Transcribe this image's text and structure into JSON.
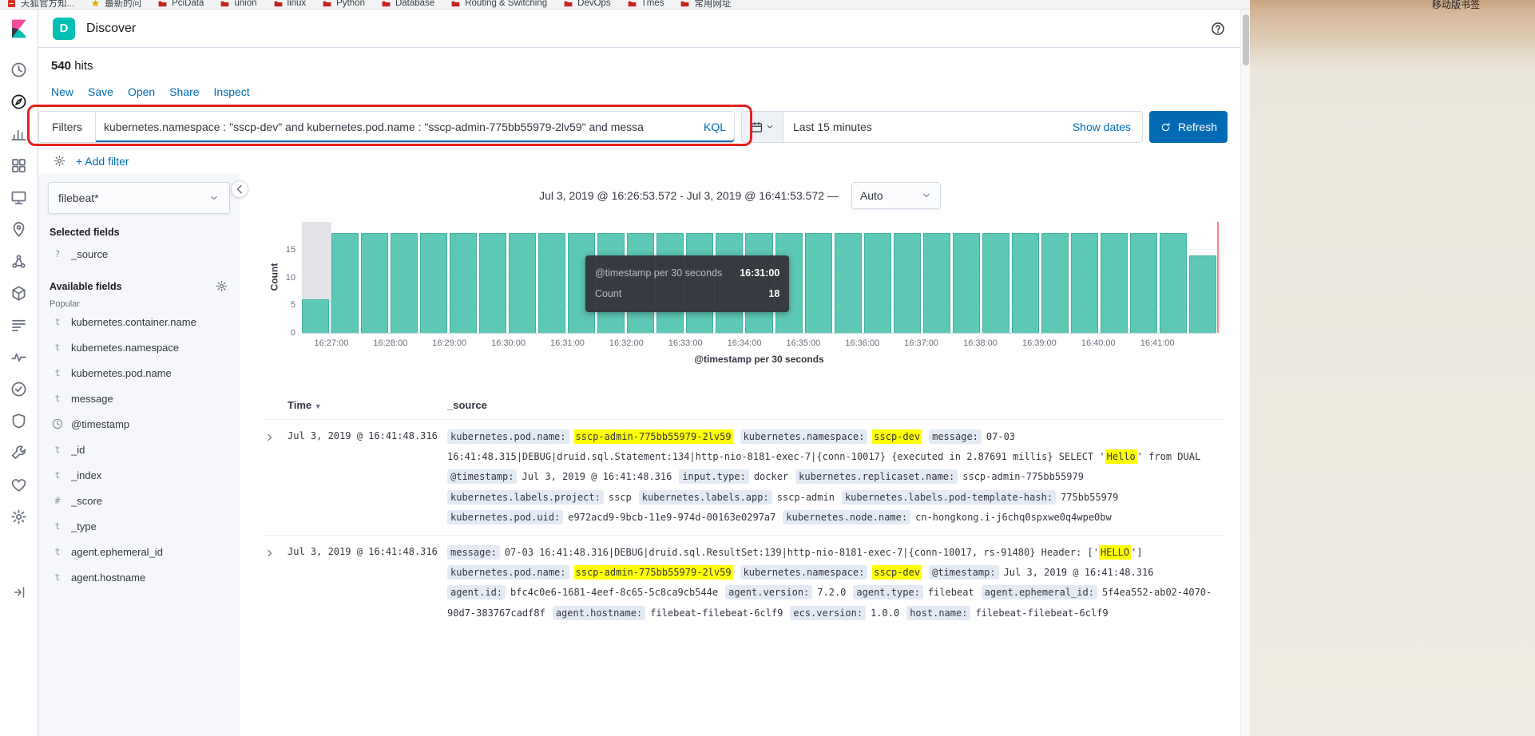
{
  "colors": {
    "accent": "#006bb4",
    "space_badge": "#00bfb3",
    "bar_fill": "#5dc8b6",
    "highlight": "#ffff00",
    "annotation": "#e0231e"
  },
  "browser": {
    "bookmarks": [
      {
        "label": "天狐官方知...",
        "icon": "site"
      },
      {
        "label": "最新的问",
        "icon": "star"
      },
      {
        "label": "PciData",
        "icon": "folder"
      },
      {
        "label": "union",
        "icon": "folder"
      },
      {
        "label": "linux",
        "icon": "folder"
      },
      {
        "label": "Python",
        "icon": "folder"
      },
      {
        "label": "Database",
        "icon": "folder"
      },
      {
        "label": "Routing & Switching",
        "icon": "folder"
      },
      {
        "label": "DevOps",
        "icon": "folder"
      },
      {
        "label": "Tmes",
        "icon": "folder"
      },
      {
        "label": "常用网址",
        "icon": "folder"
      }
    ],
    "right_text": "移动版书签"
  },
  "app_header": {
    "space_initial": "D",
    "title": "Discover"
  },
  "hits": {
    "count": "540",
    "label": "hits"
  },
  "menu": {
    "items": [
      "New",
      "Save",
      "Open",
      "Share",
      "Inspect"
    ]
  },
  "query_bar": {
    "filters_label": "Filters",
    "query": "kubernetes.namespace : \"sscp-dev\" and kubernetes.pod.name : \"sscp-admin-775bb55979-2lv59\"   and messa",
    "language": "KQL",
    "time_range": "Last 15 minutes",
    "show_dates_label": "Show dates",
    "refresh_label": "Refresh"
  },
  "filter_bar": {
    "add_filter_label": "+ Add filter"
  },
  "nav": {
    "items": [
      {
        "name": "recently-viewed",
        "icon": "clock"
      },
      {
        "name": "discover",
        "icon": "compass",
        "active": true
      },
      {
        "name": "visualize",
        "icon": "visualize"
      },
      {
        "name": "dashboard",
        "icon": "dashboard"
      },
      {
        "name": "canvas",
        "icon": "canvas"
      },
      {
        "name": "maps",
        "icon": "maps"
      },
      {
        "name": "machine-learning",
        "icon": "ml"
      },
      {
        "name": "infrastructure",
        "icon": "infrastructure"
      },
      {
        "name": "logs",
        "icon": "logs"
      },
      {
        "name": "apm",
        "icon": "apm"
      },
      {
        "name": "uptime",
        "icon": "uptime"
      },
      {
        "name": "siem",
        "icon": "siem"
      },
      {
        "name": "dev-tools",
        "icon": "wrench"
      },
      {
        "name": "stack-monitoring",
        "icon": "heart"
      },
      {
        "name": "management",
        "icon": "gear"
      }
    ]
  },
  "fields_panel": {
    "index_pattern": "filebeat*",
    "selected_title": "Selected fields",
    "selected": [
      {
        "type": "?",
        "name": "_source"
      }
    ],
    "available_title": "Available fields",
    "popular_title": "Popular",
    "popular": [
      {
        "type": "t",
        "name": "kubernetes.container.name"
      },
      {
        "type": "t",
        "name": "kubernetes.namespace"
      },
      {
        "type": "t",
        "name": "kubernetes.pod.name"
      },
      {
        "type": "t",
        "name": "message"
      }
    ],
    "available": [
      {
        "type": "clock",
        "name": "@timestamp"
      },
      {
        "type": "t",
        "name": "_id"
      },
      {
        "type": "t",
        "name": "_index"
      },
      {
        "type": "#",
        "name": "_score"
      },
      {
        "type": "t",
        "name": "_type"
      },
      {
        "type": "t",
        "name": "agent.ephemeral_id"
      },
      {
        "type": "t",
        "name": "agent.hostname"
      }
    ]
  },
  "chart": {
    "time_range_title": "Jul 3, 2019 @ 16:26:53.572 - Jul 3, 2019 @ 16:41:53.572 —",
    "interval_label": "Auto",
    "tooltip": {
      "series_label": "@timestamp per 30 seconds",
      "bucket": "16:31:00",
      "count_label": "Count",
      "count_value": "18"
    }
  },
  "chart_data": {
    "type": "bar",
    "title": "",
    "xlabel": "@timestamp per 30 seconds",
    "ylabel": "Count",
    "ylim": [
      0,
      20
    ],
    "yticks": [
      0,
      5,
      10,
      15
    ],
    "bucket_interval": "30 seconds",
    "time_range": [
      "16:26:53.572",
      "16:41:53.572"
    ],
    "x_tick_labels": [
      "16:27:00",
      "16:28:00",
      "16:29:00",
      "16:30:00",
      "16:31:00",
      "16:32:00",
      "16:33:00",
      "16:34:00",
      "16:35:00",
      "16:36:00",
      "16:37:00",
      "16:38:00",
      "16:39:00",
      "16:40:00",
      "16:41:00"
    ],
    "values": [
      6,
      18,
      18,
      18,
      18,
      18,
      18,
      18,
      18,
      18,
      18,
      18,
      18,
      18,
      18,
      18,
      18,
      18,
      18,
      18,
      18,
      18,
      18,
      18,
      18,
      18,
      18,
      18,
      18,
      18,
      14
    ],
    "shaded_index": 0,
    "hovered_bucket": {
      "x": "16:31:00",
      "count": 18
    },
    "legend": "off",
    "grid": "on"
  },
  "table": {
    "columns": {
      "time": "Time",
      "source": "_source"
    },
    "rows": [
      {
        "time": "Jul 3, 2019 @ 16:41:48.316",
        "source": [
          {
            "name": "kubernetes.pod.name",
            "parts": [
              {
                "t": "sscp-admin-775bb55979-2lv59",
                "h": true
              }
            ]
          },
          {
            "name": "kubernetes.namespace",
            "parts": [
              {
                "t": "sscp-dev",
                "h": true
              }
            ]
          },
          {
            "name": "message",
            "parts": [
              {
                "t": "07-03 16:41:48.315|DEBUG|druid.sql.Statement:134|http-nio-8181-exec-7|{conn-10017} {executed in 2.87691 millis} SELECT '",
                "h": false
              },
              {
                "t": "Hello",
                "h": true
              },
              {
                "t": "' from DUAL",
                "h": false
              }
            ]
          },
          {
            "name": "@timestamp",
            "parts": [
              {
                "t": "Jul 3, 2019 @ 16:41:48.316",
                "h": false
              }
            ]
          },
          {
            "name": "input.type",
            "parts": [
              {
                "t": "docker",
                "h": false
              }
            ]
          },
          {
            "name": "kubernetes.replicaset.name",
            "parts": [
              {
                "t": "sscp-admin-775bb55979",
                "h": false
              }
            ]
          },
          {
            "name": "kubernetes.labels.project",
            "parts": [
              {
                "t": "sscp",
                "h": false
              }
            ]
          },
          {
            "name": "kubernetes.labels.app",
            "parts": [
              {
                "t": "sscp-admin",
                "h": false
              }
            ]
          },
          {
            "name": "kubernetes.labels.pod-template-hash",
            "parts": [
              {
                "t": "775bb55979",
                "h": false
              }
            ]
          },
          {
            "name": "kubernetes.pod.uid",
            "parts": [
              {
                "t": "e972acd9-9bcb-11e9-974d-00163e0297a7",
                "h": false
              }
            ]
          },
          {
            "name": "kubernetes.node.name",
            "parts": [
              {
                "t": "cn-hongkong.i-j6chq0spxwe0q4wpe0bw",
                "h": false
              }
            ]
          }
        ]
      },
      {
        "time": "Jul 3, 2019 @ 16:41:48.316",
        "source": [
          {
            "name": "message",
            "parts": [
              {
                "t": "07-03 16:41:48.316|DEBUG|druid.sql.ResultSet:139|http-nio-8181-exec-7|{conn-10017, rs-91480} Header: ['",
                "h": false
              },
              {
                "t": "HELLO",
                "h": true
              },
              {
                "t": "']",
                "h": false
              }
            ]
          },
          {
            "name": "kubernetes.pod.name",
            "parts": [
              {
                "t": "sscp-admin-775bb55979-2lv59",
                "h": true
              }
            ]
          },
          {
            "name": "kubernetes.namespace",
            "parts": [
              {
                "t": "sscp-dev",
                "h": true
              }
            ]
          },
          {
            "name": "@timestamp",
            "parts": [
              {
                "t": "Jul 3, 2019 @ 16:41:48.316",
                "h": false
              }
            ]
          },
          {
            "name": "agent.id",
            "parts": [
              {
                "t": "bfc4c0e6-1681-4eef-8c65-5c8ca9cb544e",
                "h": false
              }
            ]
          },
          {
            "name": "agent.version",
            "parts": [
              {
                "t": "7.2.0",
                "h": false
              }
            ]
          },
          {
            "name": "agent.type",
            "parts": [
              {
                "t": "filebeat",
                "h": false
              }
            ]
          },
          {
            "name": "agent.ephemeral_id",
            "parts": [
              {
                "t": "5f4ea552-ab02-4070-90d7-383767cadf8f",
                "h": false
              }
            ]
          },
          {
            "name": "agent.hostname",
            "parts": [
              {
                "t": "filebeat-filebeat-6clf9",
                "h": false
              }
            ]
          },
          {
            "name": "ecs.version",
            "parts": [
              {
                "t": "1.0.0",
                "h": false
              }
            ]
          },
          {
            "name": "host.name",
            "parts": [
              {
                "t": "filebeat-filebeat-6clf9",
                "h": false
              }
            ]
          }
        ]
      }
    ]
  }
}
